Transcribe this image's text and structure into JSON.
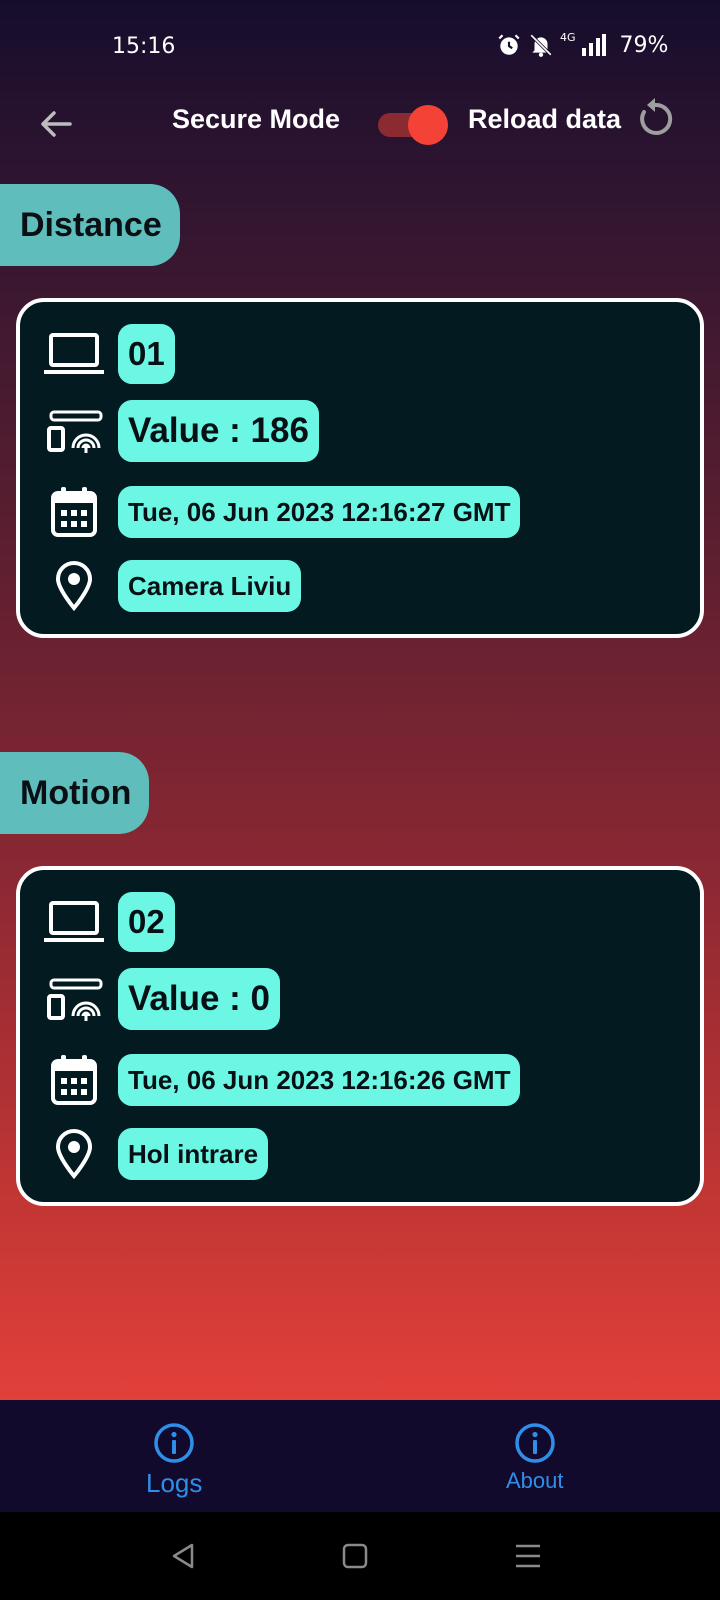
{
  "status_bar": {
    "time": "15:16",
    "network": "4G",
    "battery": "79%",
    "icons": [
      "alarm-icon",
      "bell-muted-icon",
      "signal-icon"
    ]
  },
  "top_bar": {
    "secure_mode_label": "Secure Mode",
    "secure_mode_on": true,
    "reload_label": "Reload data"
  },
  "sections": [
    {
      "title": "Distance",
      "device_id": "01",
      "value_text": "Value : 186",
      "timestamp": "Tue, 06 Jun 2023 12:16:27 GMT",
      "location": "Camera Liviu"
    },
    {
      "title": "Motion",
      "device_id": "02",
      "value_text": "Value : 0",
      "timestamp": "Tue, 06 Jun 2023 12:16:26 GMT",
      "location": "Hol intrare"
    }
  ],
  "bottom_nav": {
    "items": [
      {
        "label": "Logs",
        "icon": "info-icon"
      },
      {
        "label": "About",
        "icon": "info-icon"
      }
    ]
  },
  "colors": {
    "accent_chip": "#5fbdbc",
    "pill": "#6bf7e4",
    "card_bg": "#021a20",
    "toggle_on": "#f44336",
    "nav_link": "#2f8ee8"
  }
}
